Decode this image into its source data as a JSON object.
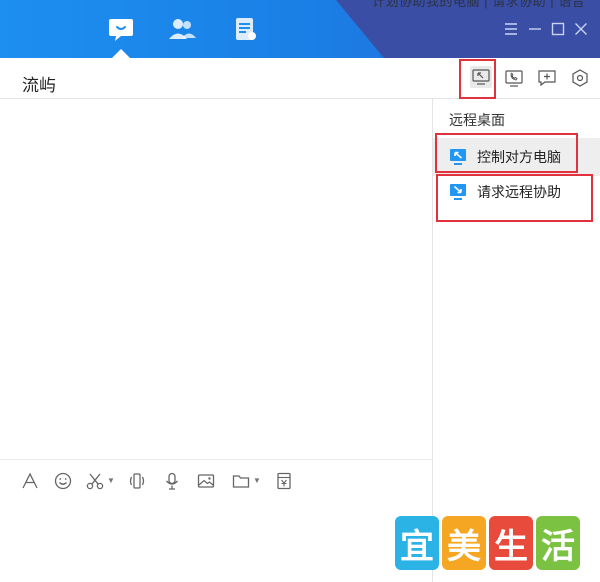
{
  "titlebar": {
    "top_text": "计划协助我的电脑 | 请求协助 | 语音",
    "tabs": [
      {
        "name": "messages",
        "icon": "chat-bubble-icon",
        "active": true
      },
      {
        "name": "contacts",
        "icon": "contacts-icon",
        "active": false
      },
      {
        "name": "documents",
        "icon": "document-icon",
        "active": false
      }
    ],
    "window_buttons": [
      "menu-icon",
      "minimize-icon",
      "maximize-icon",
      "close-icon"
    ]
  },
  "chat": {
    "title": "流屿"
  },
  "header_buttons": [
    {
      "icon": "remote-desktop-icon",
      "highlighted": true
    },
    {
      "icon": "phone-call-icon",
      "highlighted": false
    },
    {
      "icon": "add-chat-icon",
      "highlighted": false
    },
    {
      "icon": "settings-hexagon-icon",
      "highlighted": false
    }
  ],
  "side_panel": {
    "title": "远程桌面",
    "items": [
      {
        "label": "控制对方电脑",
        "icon": "control-remote-icon",
        "hovered": true
      },
      {
        "label": "请求远程协助",
        "icon": "request-assist-icon",
        "hovered": false
      }
    ]
  },
  "toolbar": [
    "font-icon",
    "emoji-icon",
    "scissors-icon",
    "shake-icon",
    "microphone-icon",
    "image-icon",
    "folder-icon",
    "red-packet-icon"
  ],
  "watermark": {
    "chars": [
      "宜",
      "美",
      "生",
      "活"
    ],
    "colors": [
      "#2bb3e6",
      "#f5a623",
      "#e84a3c",
      "#7cc242"
    ]
  },
  "colors": {
    "accent": "#1d8ff0",
    "highlight": "#e0313c",
    "icon_blue": "#2196f3"
  }
}
